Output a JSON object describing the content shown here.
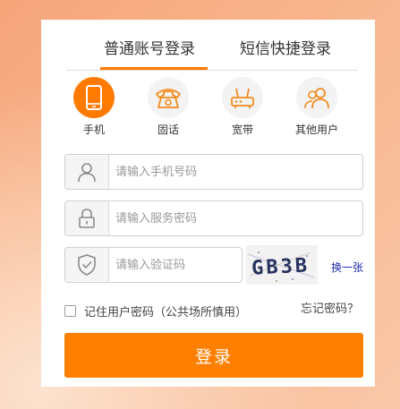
{
  "tabs": [
    {
      "label": "普通账号登录",
      "active": true
    },
    {
      "label": "短信快捷登录",
      "active": false
    }
  ],
  "login_types": [
    {
      "label": "手机",
      "icon": "mobile-phone-icon",
      "active": true
    },
    {
      "label": "固话",
      "icon": "telephone-icon",
      "active": false
    },
    {
      "label": "宽带",
      "icon": "router-icon",
      "active": false
    },
    {
      "label": "其他用户",
      "icon": "users-icon",
      "active": false
    }
  ],
  "fields": {
    "phone": {
      "placeholder": "请输入手机号码",
      "icon": "user-icon",
      "value": ""
    },
    "password": {
      "placeholder": "请输入服务密码",
      "icon": "lock-icon",
      "value": ""
    },
    "code": {
      "placeholder": "请输入验证码",
      "icon": "shield-check-icon",
      "value": ""
    }
  },
  "captcha": {
    "text": "GB3B",
    "refresh_label": "换一张"
  },
  "remember": {
    "label": "记住用户密码（公共场所慎用）",
    "checked": false
  },
  "forgot_label": "忘记密码？",
  "login_button": "登录",
  "colors": {
    "accent": "#ff7a00",
    "link": "#1d2db0",
    "text": "#333333",
    "placeholder": "#999999"
  }
}
